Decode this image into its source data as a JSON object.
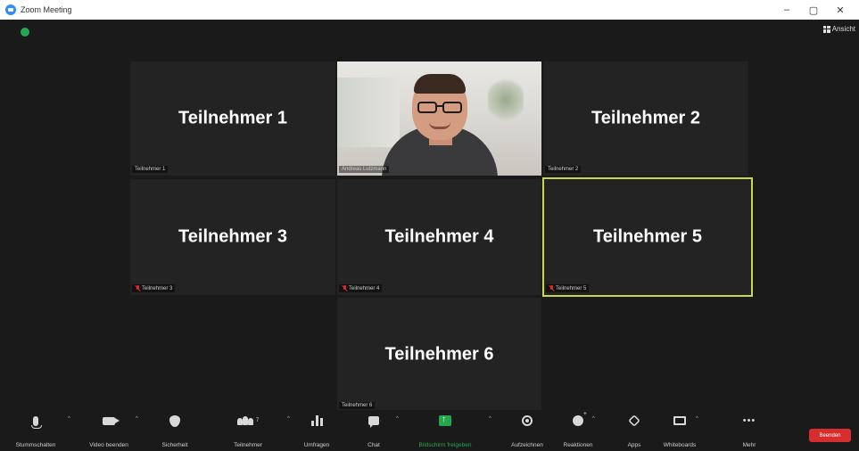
{
  "window": {
    "title": "Zoom Meeting",
    "minimize": "–",
    "maximize": "▢",
    "close": "✕"
  },
  "meeting": {
    "view_label": "Ansicht",
    "tiles": [
      {
        "display_name": "Teilnehmer 1",
        "label": "Teilnehmer 1",
        "muted": false
      },
      {
        "display_name": "",
        "label": "Andreas Lutzmann",
        "muted": false,
        "video": true
      },
      {
        "display_name": "Teilnehmer 2",
        "label": "Teilnehmer 2",
        "muted": false
      },
      {
        "display_name": "Teilnehmer 3",
        "label": "Teilnehmer 3",
        "muted": true
      },
      {
        "display_name": "Teilnehmer 4",
        "label": "Teilnehmer 4",
        "muted": true
      },
      {
        "display_name": "Teilnehmer 5",
        "label": "Teilnehmer 5",
        "muted": true,
        "active_speaker": true
      },
      {
        "display_name": "Teilnehmer 6",
        "label": "Teilnehmer 6",
        "muted": false
      }
    ]
  },
  "toolbar": {
    "mute": "Stummschalten",
    "video": "Video beenden",
    "security": "Sicherheit",
    "participants": "Teilnehmer",
    "participants_count": "7",
    "polls": "Umfragen",
    "chat": "Chat",
    "share": "Bildschirm freigeben",
    "record": "Aufzeichnen",
    "reactions": "Reaktionen",
    "apps": "Apps",
    "whiteboards": "Whiteboards",
    "more": "Mehr",
    "more_glyph": "•••",
    "end": "Beenden",
    "caret": "^"
  },
  "colors": {
    "active_speaker_border": "#c8d84a",
    "share_green": "#23a850",
    "end_red": "#d62e2e",
    "muted_red": "#e02828"
  }
}
